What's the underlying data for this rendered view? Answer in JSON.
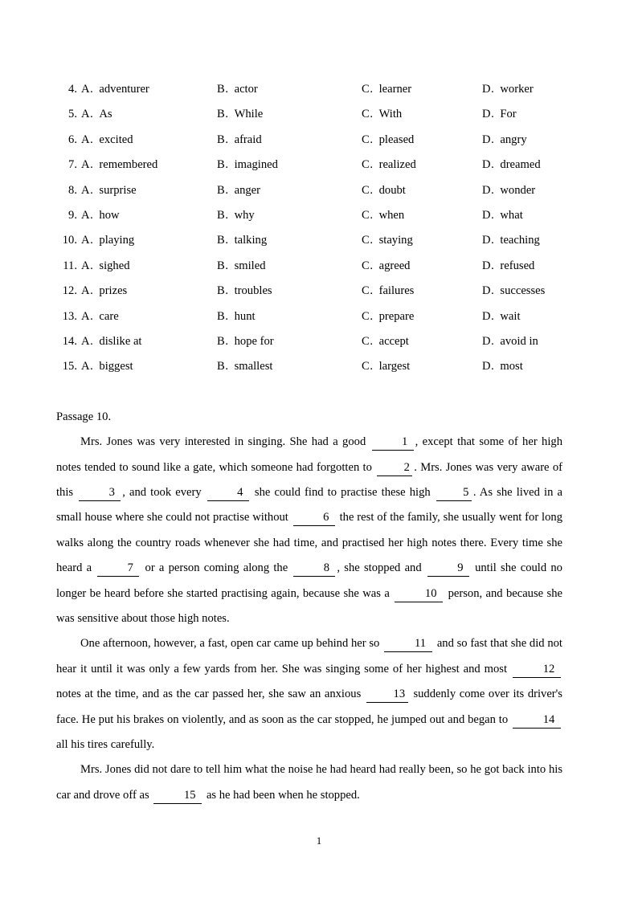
{
  "document": {
    "page_number": "1",
    "passage_heading": "Passage 10."
  },
  "options": {
    "rows": [
      {
        "num": "4.",
        "a_label": "A.",
        "a": "adventurer",
        "b_label": "B.",
        "b": "actor",
        "c_label": "C.",
        "c": "learner",
        "d_label": "D.",
        "d": "worker"
      },
      {
        "num": "5.",
        "a_label": "A.",
        "a": "As",
        "b_label": "B.",
        "b": "While",
        "c_label": "C.",
        "c": "With",
        "d_label": "D.",
        "d": "For"
      },
      {
        "num": "6.",
        "a_label": "A.",
        "a": "excited",
        "b_label": "B.",
        "b": "afraid",
        "c_label": "C.",
        "c": "pleased",
        "d_label": "D.",
        "d": "angry"
      },
      {
        "num": "7.",
        "a_label": "A.",
        "a": "remembered",
        "b_label": "B.",
        "b": "imagined",
        "c_label": "C.",
        "c": "realized",
        "d_label": "D.",
        "d": "dreamed"
      },
      {
        "num": "8.",
        "a_label": "A.",
        "a": "surprise",
        "b_label": "B.",
        "b": "anger",
        "c_label": "C.",
        "c": "doubt",
        "d_label": "D.",
        "d": "wonder"
      },
      {
        "num": "9.",
        "a_label": "A.",
        "a": "how",
        "b_label": "B.",
        "b": "why",
        "c_label": "C.",
        "c": "when",
        "d_label": "D.",
        "d": "what"
      },
      {
        "num": "10.",
        "a_label": "A.",
        "a": "playing",
        "b_label": "B.",
        "b": "talking",
        "c_label": "C.",
        "c": "staying",
        "d_label": "D.",
        "d": "teaching"
      },
      {
        "num": "11.",
        "a_label": "A.",
        "a": "sighed",
        "b_label": "B.",
        "b": "smiled",
        "c_label": "C.",
        "c": "agreed",
        "d_label": "D.",
        "d": "refused"
      },
      {
        "num": "12.",
        "a_label": "A.",
        "a": "prizes",
        "b_label": "B.",
        "b": "troubles",
        "c_label": "C.",
        "c": "failures",
        "d_label": "D.",
        "d": "successes"
      },
      {
        "num": "13.",
        "a_label": "A.",
        "a": "care",
        "b_label": "B.",
        "b": "hunt",
        "c_label": "C.",
        "c": "prepare",
        "d_label": "D.",
        "d": "wait"
      },
      {
        "num": "14.",
        "a_label": "A.",
        "a": "dislike at",
        "b_label": "B.",
        "b": "hope for",
        "c_label": "C.",
        "c": "accept",
        "d_label": "D.",
        "d": "avoid in"
      },
      {
        "num": "15.",
        "a_label": "A.",
        "a": "biggest",
        "b_label": "B.",
        "b": "smallest",
        "c_label": "C.",
        "c": "largest",
        "d_label": "D.",
        "d": "most"
      }
    ]
  },
  "passage": {
    "p1": {
      "s1": "Mrs. Jones was very interested in singing. She had a good",
      "blank1": "1",
      "s2": ", except that some of her high notes tended to sound like a gate, which someone had forgotten to",
      "blank2": "2",
      "s3": ". Mrs. Jones was very aware of this",
      "blank3": "3",
      "s4": ", and took every",
      "blank4": "4",
      "s5": "she could find to practise these high",
      "blank5": "5",
      "s6": ". As she lived in a small house where she could not practise without",
      "blank6": "6",
      "s7": "the rest of the family, she usually went for long walks along the country roads whenever she had time, and practised her high notes there. Every time she heard a",
      "blank7": "7",
      "s8": "or a person coming along the",
      "blank8": "8",
      "s9": ", she stopped and",
      "blank9": "9",
      "s10": "until she could no longer be heard before she started practising again, because she was a",
      "blank10": "10",
      "s11": "person, and because she was sensitive about those high notes."
    },
    "p2": {
      "s1": "One afternoon, however, a fast, open car came up behind her so",
      "blank11": "11",
      "s2": "and so fast that she did not hear it until it was only a few yards from her. She was singing some of her highest and most",
      "blank12": "12",
      "s3": "notes at the time, and as the car passed her, she saw an anxious",
      "blank13": "13",
      "s4": "suddenly come over its driver's face. He put his brakes on violently, and as soon as the car stopped, he jumped out and began to",
      "blank14": "14",
      "s5": "all his tires carefully."
    },
    "p3": {
      "s1": "Mrs. Jones did not dare to tell him what the noise he had heard had really been, so he got back into his car and drove off as",
      "blank15": "15",
      "s2": "as he had been when he stopped."
    }
  }
}
